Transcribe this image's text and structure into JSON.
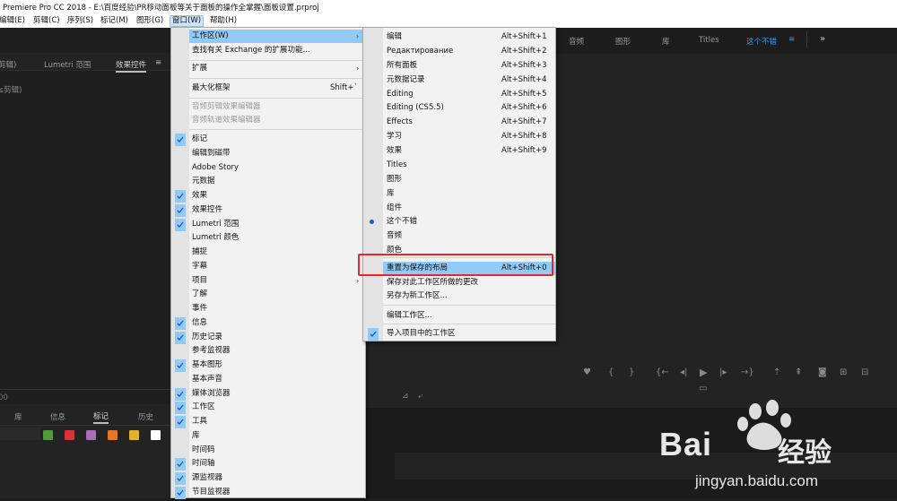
{
  "window": {
    "title": "Premiere Pro CC 2018 - E:\\百度经验\\PR移动面板等关于面板的操作全掌握\\面板设置.prproj"
  },
  "menubar": [
    {
      "label": "编辑(E)"
    },
    {
      "label": "剪辑(C)"
    },
    {
      "label": "序列(S)"
    },
    {
      "label": "标记(M)"
    },
    {
      "label": "图形(G)"
    },
    {
      "label": "窗口(W)"
    },
    {
      "label": "帮助(H)"
    }
  ],
  "left_panel": {
    "tabs": [
      "剪辑)",
      "Lumetri 范围",
      "效果控件"
    ],
    "sublabel": "≤剪辑)",
    "timecode": "00",
    "bottom_tabs": [
      "库",
      "信息",
      "标记",
      "历史"
    ],
    "label_colors": [
      "#4f9b3a",
      "#d8323b",
      "#a56fb5",
      "#e0772a",
      "#e0b12a",
      "#ffffff"
    ]
  },
  "top_tabs": [
    "音频",
    "图形",
    "库",
    "Titles",
    "这个不错",
    "»"
  ],
  "window_menu": {
    "items": [
      {
        "label": "工作区(W)",
        "submenu": true,
        "highlighted": true
      },
      {
        "label": "查找有关 Exchange 的扩展功能..."
      },
      {
        "label": "扩展",
        "submenu": true
      },
      {
        "label": "最大化框架",
        "shortcut": "Shift+`"
      },
      {
        "label": "音频剪辑效果编辑器",
        "disabled": true
      },
      {
        "label": "音频轨道效果编辑器",
        "disabled": true
      },
      {
        "label": "标记",
        "checked": true
      },
      {
        "label": "编辑到磁带"
      },
      {
        "label": "Adobe Story"
      },
      {
        "label": "元数据"
      },
      {
        "label": "效果",
        "checked": true
      },
      {
        "label": "效果控件",
        "checked": true
      },
      {
        "label": "Lumetri 范围",
        "checked": true
      },
      {
        "label": "Lumetri 颜色"
      },
      {
        "label": "捕捉"
      },
      {
        "label": "字幕"
      },
      {
        "label": "项目",
        "submenu": true
      },
      {
        "label": "了解"
      },
      {
        "label": "事件"
      },
      {
        "label": "信息",
        "checked": true
      },
      {
        "label": "历史记录",
        "checked": true
      },
      {
        "label": "参考监视器"
      },
      {
        "label": "基本图形",
        "checked": true
      },
      {
        "label": "基本声音"
      },
      {
        "label": "媒体浏览器",
        "checked": true
      },
      {
        "label": "工作区",
        "checked": true
      },
      {
        "label": "工具",
        "checked": true
      },
      {
        "label": "库"
      },
      {
        "label": "时间码"
      },
      {
        "label": "时间轴",
        "checked": true
      },
      {
        "label": "源监视器",
        "checked": true
      },
      {
        "label": "节目监视器",
        "checked": true
      }
    ]
  },
  "workspace_menu": {
    "items": [
      {
        "label": "编辑",
        "shortcut": "Alt+Shift+1"
      },
      {
        "label": "Редактирование",
        "shortcut": "Alt+Shift+2"
      },
      {
        "label": "所有面板",
        "shortcut": "Alt+Shift+3"
      },
      {
        "label": "元数据记录",
        "shortcut": "Alt+Shift+4"
      },
      {
        "label": "Editing",
        "shortcut": "Alt+Shift+5"
      },
      {
        "label": "Editing (CS5.5)",
        "shortcut": "Alt+Shift+6"
      },
      {
        "label": "Effects",
        "shortcut": "Alt+Shift+7"
      },
      {
        "label": "学习",
        "shortcut": "Alt+Shift+8"
      },
      {
        "label": "效果",
        "shortcut": "Alt+Shift+9"
      },
      {
        "label": "Titles"
      },
      {
        "label": "图形"
      },
      {
        "label": "库"
      },
      {
        "label": "组件"
      },
      {
        "label": "这个不错",
        "selected": true
      },
      {
        "label": "音频"
      },
      {
        "label": "颜色"
      },
      {
        "label": "重置为保存的布局",
        "shortcut": "Alt+Shift+0",
        "highlighted": true
      },
      {
        "label": "保存对此工作区所做的更改"
      },
      {
        "label": "另存为新工作区..."
      },
      {
        "label": "编辑工作区..."
      },
      {
        "label": "导入项目中的工作区",
        "checked": true
      }
    ]
  },
  "watermark": {
    "brand_left": "Bai",
    "brand_right": "经验",
    "url": "jingyan.baidu.com"
  }
}
